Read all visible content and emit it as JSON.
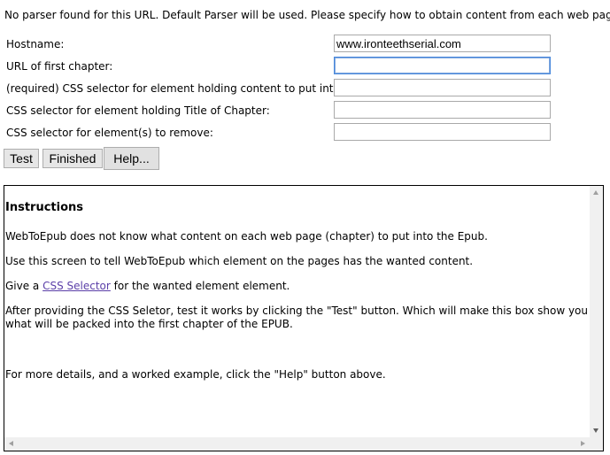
{
  "notice": "No parser found for this URL. Default Parser will be used. Please specify how to obtain content from each web page.",
  "form": {
    "hostname": {
      "label": "Hostname:",
      "value": "www.ironteethserial.com"
    },
    "first_chapter_url": {
      "label": "URL of first chapter:",
      "value": ""
    },
    "content_selector": {
      "label": "(required) CSS selector for element holding content to put into EPUB:",
      "value": ""
    },
    "title_selector": {
      "label": "CSS selector for element holding Title of Chapter:",
      "value": ""
    },
    "remove_selector": {
      "label": "CSS selector for element(s) to remove:",
      "value": ""
    }
  },
  "buttons": {
    "test": "Test",
    "finished": "Finished",
    "help": "Help..."
  },
  "instructions": {
    "heading": "Instructions",
    "p1": "WebToEpub does not know what content on each web page (chapter) to put into the Epub.",
    "p2": "Use this screen to tell WebToEpub which element on the pages has the wanted content.",
    "p3_before": "Give a ",
    "p3_link": "CSS Selector",
    "p3_after": " for the wanted element element.",
    "p4": "After providing the CSS Seletor, test it works by clicking the \"Test\" button. Which will make this box show you what will be packed into the first chapter of the EPUB.",
    "p5": "For more details, and a worked example, click the \"Help\" button above."
  }
}
